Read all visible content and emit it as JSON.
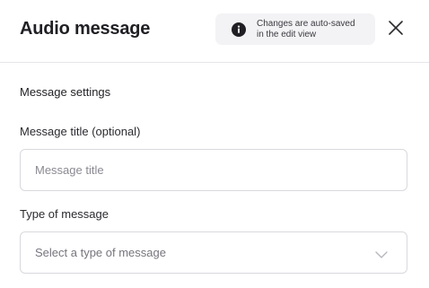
{
  "header": {
    "title": "Audio message",
    "notice": {
      "line1": "Changes are auto-saved",
      "line2": "in the edit view",
      "icon": "info-icon"
    },
    "close_icon": "close-icon"
  },
  "settings": {
    "section_heading": "Message settings",
    "title_field": {
      "label": "Message title (optional)",
      "value": "",
      "placeholder": "Message title"
    },
    "type_field": {
      "label": "Type of message",
      "selected": "Select a type of message",
      "icon": "chevron-down-icon"
    }
  },
  "colors": {
    "text": "#1f1f24",
    "border": "#d9d9de",
    "notice_bg": "#f3f3f5",
    "placeholder": "#8a8a92"
  }
}
